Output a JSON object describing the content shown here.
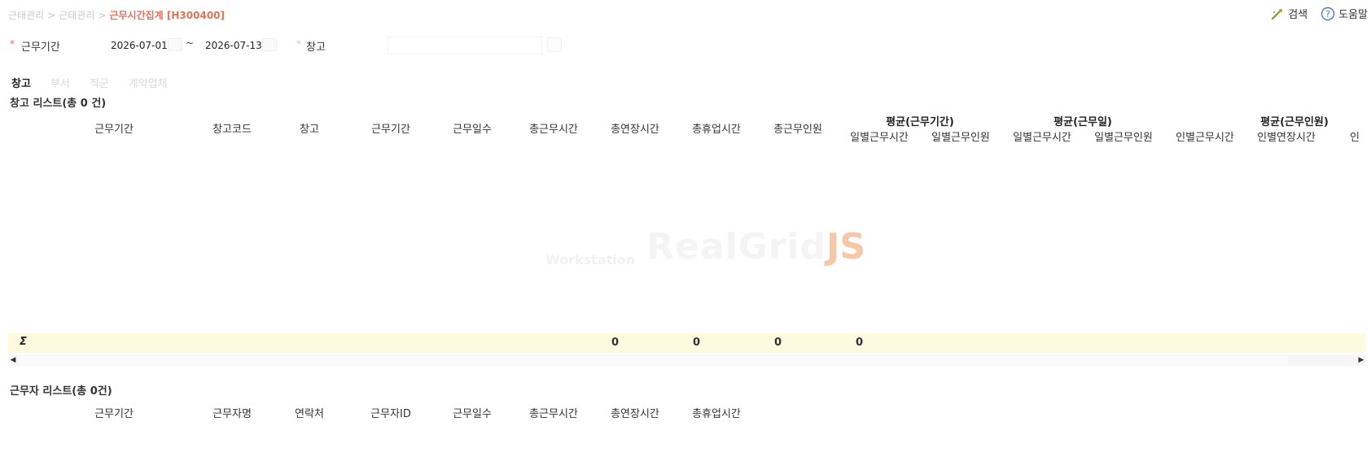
{
  "breadcrumb": {
    "items": [
      "근태관리",
      "근태관리"
    ],
    "separator": ">",
    "current": "근무시간집계 [H300400]"
  },
  "actions": {
    "search_label": "검색",
    "help_label": "도움말"
  },
  "filters": {
    "period_label": "근무기간",
    "date_from": "2026-07-01",
    "date_to": "2026-07-13",
    "tilde": "~",
    "warehouse_label": "창고",
    "required_mark": "*"
  },
  "tabs": [
    {
      "label": "창고",
      "active": true
    },
    {
      "label": "부서",
      "active": false
    },
    {
      "label": "직군",
      "active": false
    },
    {
      "label": "계약업체",
      "active": false
    }
  ],
  "grid1": {
    "title": "창고 리스트(총 0 건)",
    "columns": [
      "근무기간",
      "창고코드",
      "창고",
      "근무기간",
      "근무일수",
      "총근무시간",
      "총연장시간",
      "총휴업시간",
      "총근무인원"
    ],
    "groups": [
      {
        "label": "평균(근무기간)",
        "sub": [
          "일별근무시간",
          "일별근무인원"
        ]
      },
      {
        "label": "평균(근무일)",
        "sub": [
          "일별근무시간",
          "일별근무인원"
        ]
      },
      {
        "label": "평균(근무인원)",
        "sub": [
          "인별근무시간",
          "인별연장시간",
          "인"
        ]
      }
    ],
    "footer": {
      "sigma": "Σ",
      "sums": [
        "0",
        "0",
        "0",
        "0"
      ]
    },
    "watermark": {
      "small": "Workstation",
      "big": "RealGrid",
      "js": "JS"
    }
  },
  "grid2": {
    "title": "근무자 리스트(총 0건)",
    "columns": [
      "근무기간",
      "근무자명",
      "연락처",
      "근무자ID",
      "근무일수",
      "총근무시간",
      "총연장시간",
      "총휴업시간"
    ]
  },
  "colors": {
    "accent": "#e0735a",
    "footer_bg": "#fdfae0"
  }
}
